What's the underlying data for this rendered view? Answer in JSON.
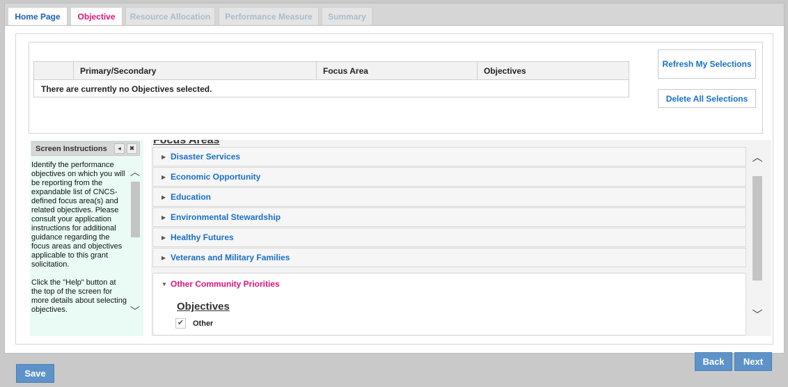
{
  "tabs": [
    {
      "label": "Home Page"
    },
    {
      "label": "Objective"
    },
    {
      "label": "Resource Allocation"
    },
    {
      "label": "Performance Measure"
    },
    {
      "label": "Summary"
    }
  ],
  "selection": {
    "columns": [
      "",
      "Primary/Secondary",
      "Focus Area",
      "Objectives"
    ],
    "empty_message": "There are currently no Objectives selected.",
    "refresh_label": "Refresh My Selections",
    "delete_label": "Delete All Selections"
  },
  "instructions": {
    "title": "Screen Instructions",
    "text": "Identify the performance objectives on which you will be reporting from the expandable list of CNCS-defined focus area(s) and related objectives. Please consult your application instructions for additional guidance regarding the focus areas and objectives applicable to this grant solicitation.\n\nClick the \"Help\" button at the top of the screen for more details about selecting objectives.",
    "collapse_glyph": "◂",
    "close_glyph": "✖"
  },
  "focus": {
    "heading": "Focus Areas",
    "items": [
      {
        "label": "Disaster Services"
      },
      {
        "label": "Economic Opportunity"
      },
      {
        "label": "Education"
      },
      {
        "label": "Environmental Stewardship"
      },
      {
        "label": "Healthy Futures"
      },
      {
        "label": "Veterans and Military Families"
      }
    ],
    "expanded": {
      "label": "Other Community Priorities",
      "objectives_heading": "Objectives",
      "checkbox_label": "Other",
      "checked": true
    }
  },
  "footer": {
    "save_label": "Save",
    "back_label": "Back",
    "next_label": "Next"
  },
  "colors": {
    "accent_blue": "#1a6fc9",
    "active_pink": "#e0137a",
    "button_blue": "#5e93c9",
    "instructions_bg": "#e9fbf4"
  }
}
